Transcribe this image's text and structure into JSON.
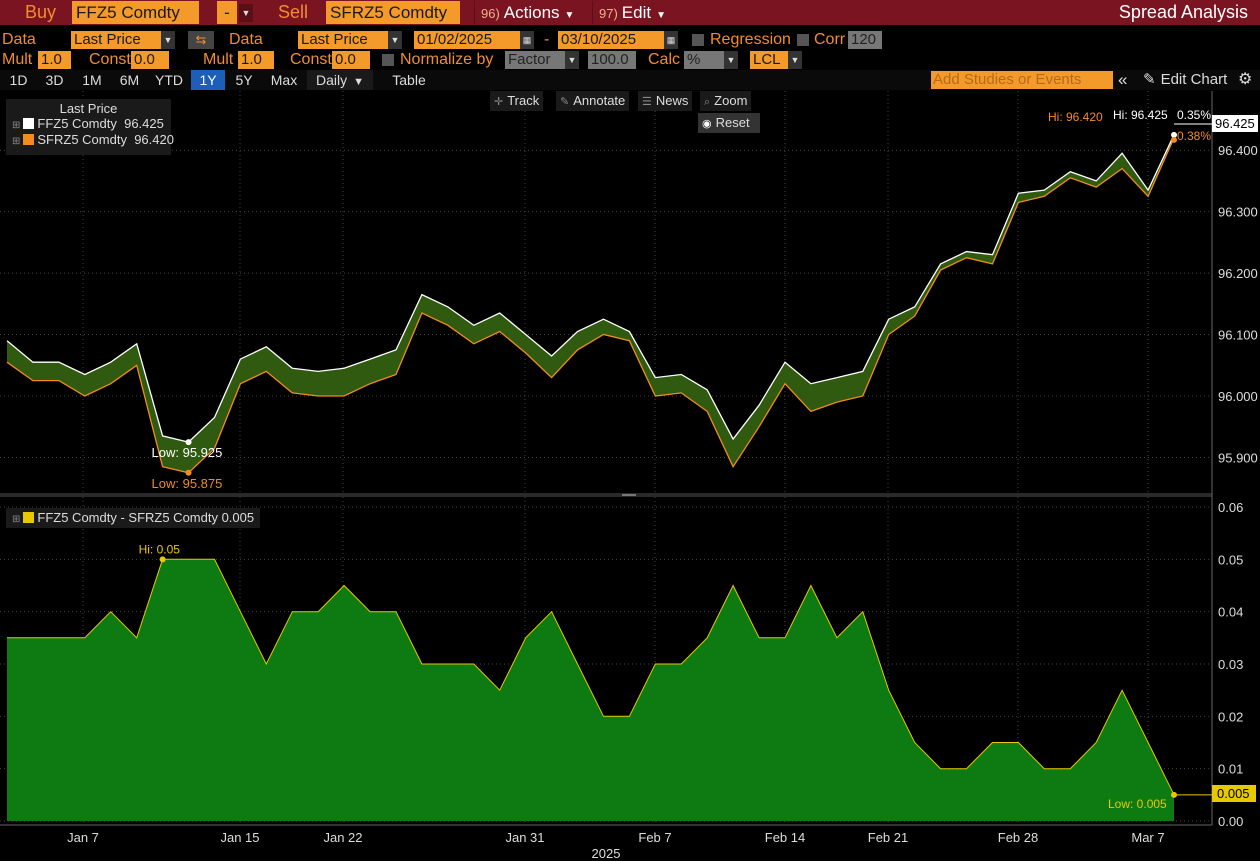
{
  "topbar": {
    "buy_label": "Buy",
    "buy_ticker": "FFZ5 Comdty",
    "operator": "-",
    "sell_label": "Sell",
    "sell_ticker": "SFRZ5 Comdty",
    "actions_num": "96)",
    "actions_label": "Actions",
    "edit_num": "97)",
    "edit_label": "Edit",
    "title": "Spread Analysis"
  },
  "controls": {
    "data_label": "Data",
    "data1_value": "Last Price",
    "data2_value": "Last Price",
    "start_date": "01/02/2025",
    "date_sep": "-",
    "end_date": "03/10/2025",
    "regression_label": "Regression",
    "corr_label": "Corr",
    "corr_value": "120",
    "mult_label": "Mult",
    "mult1_value": "1.0",
    "const_label": "Const",
    "const1_value": "0.0",
    "mult2_value": "1.0",
    "const2_value": "0.0",
    "normalize_label": "Normalize by",
    "normalize_value": "Factor",
    "factor_value": "100.0",
    "calc_label": "Calc",
    "calc_value": "%",
    "currency_value": "LCL"
  },
  "range": {
    "buttons": [
      "1D",
      "3D",
      "1M",
      "6M",
      "YTD",
      "1Y",
      "5Y",
      "Max"
    ],
    "active": "1Y",
    "frequency": "Daily",
    "table_label": "Table",
    "studies_placeholder": "Add Studies or Events",
    "collapse_label": "«",
    "edit_chart_label": "Edit Chart"
  },
  "tools": {
    "track": "Track",
    "annotate": "Annotate",
    "news": "News",
    "zoom": "Zoom",
    "reset": "Reset"
  },
  "legend_top": {
    "header": "Last Price",
    "items": [
      {
        "name": "FFZ5 Comdty",
        "value": "96.425",
        "color": "#ffffff"
      },
      {
        "name": "SFRZ5 Comdty",
        "value": "96.420",
        "color": "#f28c1e"
      }
    ]
  },
  "legend_bottom": {
    "text": "FFZ5 Comdty - SFRZ5 Comdty 0.005",
    "color": "#e8c800"
  },
  "colors": {
    "ffz5": "#ffffff",
    "sfrz5": "#f28c1e",
    "spread_fill": "#0e7a12",
    "spread_line": "#e8c800",
    "band_fill": "#2f5a10",
    "grid": "#444444",
    "accent": "#f39a2b"
  },
  "chart_data": [
    {
      "type": "line",
      "title": "",
      "x_labels": [
        "Jan 7",
        "Jan 15",
        "Jan 22",
        "Jan 31",
        "Feb 7",
        "Feb 14",
        "Feb 21",
        "Feb 28",
        "Mar 7"
      ],
      "x_axis_year": "2025",
      "ylim": [
        95.82,
        96.44
      ],
      "yticks": [
        "95.900",
        "96.000",
        "96.100",
        "96.200",
        "96.300",
        "96.400"
      ],
      "series": [
        {
          "name": "FFZ5 Comdty",
          "values": [
            96.09,
            96.055,
            96.055,
            96.035,
            96.055,
            96.085,
            95.935,
            95.925,
            95.965,
            96.06,
            96.08,
            96.045,
            96.04,
            96.045,
            96.06,
            96.075,
            96.165,
            96.145,
            96.115,
            96.135,
            96.1,
            96.065,
            96.105,
            96.125,
            96.105,
            96.03,
            96.035,
            96.01,
            95.93,
            95.985,
            96.055,
            96.02,
            96.03,
            96.04,
            96.125,
            96.145,
            96.215,
            96.235,
            96.23,
            96.33,
            96.335,
            96.365,
            96.35,
            96.395,
            96.335,
            96.425
          ]
        },
        {
          "name": "SFRZ5 Comdty",
          "values": [
            96.055,
            96.025,
            96.025,
            96.0,
            96.02,
            96.05,
            95.885,
            95.875,
            95.915,
            96.02,
            96.04,
            96.005,
            96.0,
            96.0,
            96.02,
            96.035,
            96.135,
            96.115,
            96.085,
            96.105,
            96.07,
            96.03,
            96.075,
            96.1,
            96.09,
            96.0,
            96.005,
            95.975,
            95.885,
            95.95,
            96.02,
            95.975,
            95.99,
            96.0,
            96.1,
            96.13,
            96.205,
            96.225,
            96.215,
            96.315,
            96.325,
            96.355,
            96.34,
            96.37,
            96.325,
            96.42
          ]
        }
      ],
      "annotations": {
        "ffz5_low": "Low: 95.925",
        "sfrz5_low": "Low: 95.875",
        "ffz5_hi": "Hi: 96.425",
        "sfrz5_hi": "Hi: 96.420",
        "ffz5_pct": "0.35%",
        "sfrz5_pct": "0.38%",
        "last_value": "96.425"
      }
    },
    {
      "type": "area",
      "title": "",
      "ylim": [
        0,
        0.06
      ],
      "yticks": [
        "0.00",
        "0.01",
        "0.02",
        "0.03",
        "0.04",
        "0.05",
        "0.06"
      ],
      "series": [
        {
          "name": "FFZ5 Comdty - SFRZ5 Comdty",
          "values": [
            0.035,
            0.035,
            0.035,
            0.035,
            0.04,
            0.035,
            0.05,
            0.05,
            0.05,
            0.04,
            0.03,
            0.04,
            0.04,
            0.045,
            0.04,
            0.04,
            0.03,
            0.03,
            0.03,
            0.025,
            0.035,
            0.04,
            0.03,
            0.02,
            0.02,
            0.03,
            0.03,
            0.035,
            0.045,
            0.035,
            0.035,
            0.045,
            0.035,
            0.04,
            0.025,
            0.015,
            0.01,
            0.01,
            0.015,
            0.015,
            0.01,
            0.01,
            0.015,
            0.025,
            0.015,
            0.005
          ]
        }
      ],
      "annotations": {
        "hi": "Hi: 0.05",
        "low": "Low: 0.005",
        "last_value": "0.005"
      }
    }
  ]
}
